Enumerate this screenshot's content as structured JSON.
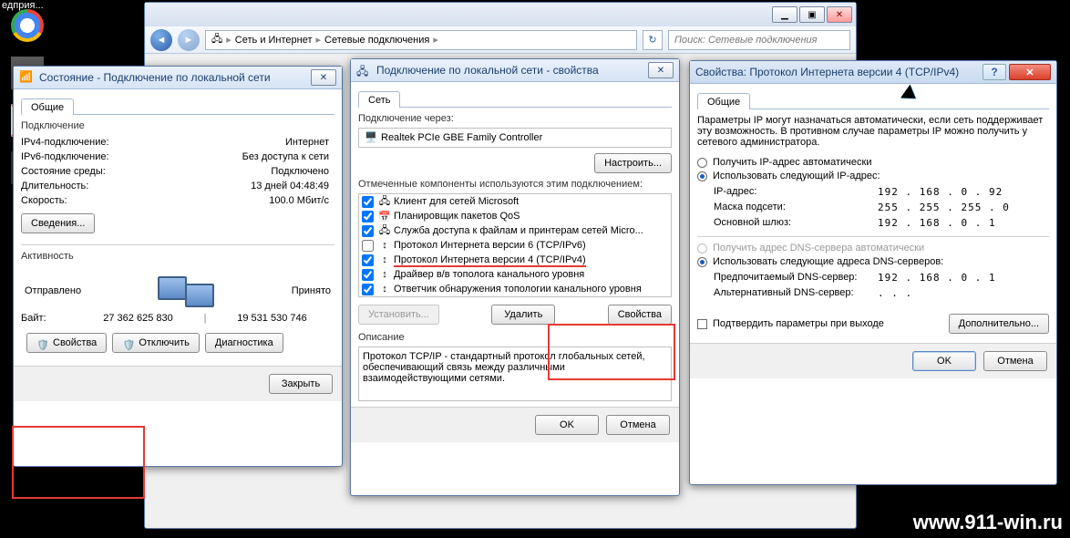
{
  "desktop": {
    "taskbar_label": "едприя..."
  },
  "explorer": {
    "path": [
      "Сеть и Интернет",
      "Сетевые подключения"
    ],
    "search_placeholder": "Поиск: Сетевые подключения",
    "sysbtns": {
      "min": "▁",
      "max": "▣",
      "close": "✕"
    },
    "nav_back": "◄",
    "nav_fwd": "►",
    "refresh": "↻"
  },
  "win1": {
    "title": "Состояние - Подключение по локальной сети",
    "close": "✕",
    "tab": "Общие",
    "section_conn": "Подключение",
    "rows": [
      {
        "k": "IPv4-подключение:",
        "v": "Интернет"
      },
      {
        "k": "IPv6-подключение:",
        "v": "Без доступа к сети"
      },
      {
        "k": "Состояние среды:",
        "v": "Подключено"
      },
      {
        "k": "Длительность:",
        "v": "13 дней 04:48:49"
      },
      {
        "k": "Скорость:",
        "v": "100.0 Мбит/с"
      }
    ],
    "details_btn": "Сведения...",
    "section_act": "Активность",
    "sent": "Отправлено",
    "recv": "Принято",
    "bytes_label": "Байт:",
    "sent_bytes": "27 362 625 830",
    "recv_bytes": "19 531 530 746",
    "btn_props": "Свойства",
    "btn_disable": "Отключить",
    "btn_diag": "Диагностика",
    "btn_close": "Закрыть"
  },
  "win2": {
    "title": "Подключение по локальной сети - свойства",
    "close": "✕",
    "tab": "Сеть",
    "connect_via": "Подключение через:",
    "adapter": "Realtek PCIe GBE Family Controller",
    "configure": "Настроить...",
    "components_label": "Отмеченные компоненты используются этим подключением:",
    "items": [
      {
        "c": true,
        "ico": "🖧",
        "t": "Клиент для сетей Microsoft"
      },
      {
        "c": true,
        "ico": "📅",
        "t": "Планировщик пакетов QoS"
      },
      {
        "c": true,
        "ico": "🖧",
        "t": "Служба доступа к файлам и принтерам сетей Micro..."
      },
      {
        "c": false,
        "ico": "↕",
        "t": "Протокол Интернета версии 6 (TCP/IPv6)"
      },
      {
        "c": true,
        "ico": "↕",
        "t": "Протокол Интернета версии 4 (TCP/IPv4)",
        "hl": true
      },
      {
        "c": true,
        "ico": "↕",
        "t": "Драйвер в/в тополога канального уровня"
      },
      {
        "c": true,
        "ico": "↕",
        "t": "Ответчик обнаружения топологии канального уровня"
      }
    ],
    "btn_install": "Установить...",
    "btn_remove": "Удалить",
    "btn_props": "Свойства",
    "desc_label": "Описание",
    "desc": "Протокол TCP/IP - стандартный протокол глобальных сетей, обеспечивающий связь между различными взаимодействующими сетями.",
    "ok": "OK",
    "cancel": "Отмена"
  },
  "win3": {
    "title": "Свойства: Протокол Интернета версии 4 (TCP/IPv4)",
    "help": "?",
    "close": "✕",
    "tab": "Общие",
    "intro": "Параметры IP могут назначаться автоматически, если сеть поддерживает эту возможность. В противном случае параметры IP можно получить у сетевого администратора.",
    "r_auto": "Получить IP-адрес автоматически",
    "r_manual": "Использовать следующий IP-адрес:",
    "ip_label": "IP-адрес:",
    "ip": "192 . 168 .  0  .  92",
    "mask_label": "Маска подсети:",
    "mask": "255 . 255 . 255 .  0",
    "gw_label": "Основной шлюз:",
    "gw": "192 . 168 .  0  .   1",
    "r_dns_auto": "Получить адрес DNS-сервера автоматически",
    "r_dns_manual": "Использовать следующие адреса DNS-серверов:",
    "dns1_label": "Предпочитаемый DNS-сервер:",
    "dns1": "192 . 168 .  0  .   1",
    "dns2_label": "Альтернативный DNS-сервер:",
    "dns2": "    .     .     .    ",
    "confirm": "Подтвердить параметры при выходе",
    "advanced": "Дополнительно...",
    "ok": "OK",
    "cancel": "Отмена"
  },
  "watermark": "www.911-win.ru"
}
